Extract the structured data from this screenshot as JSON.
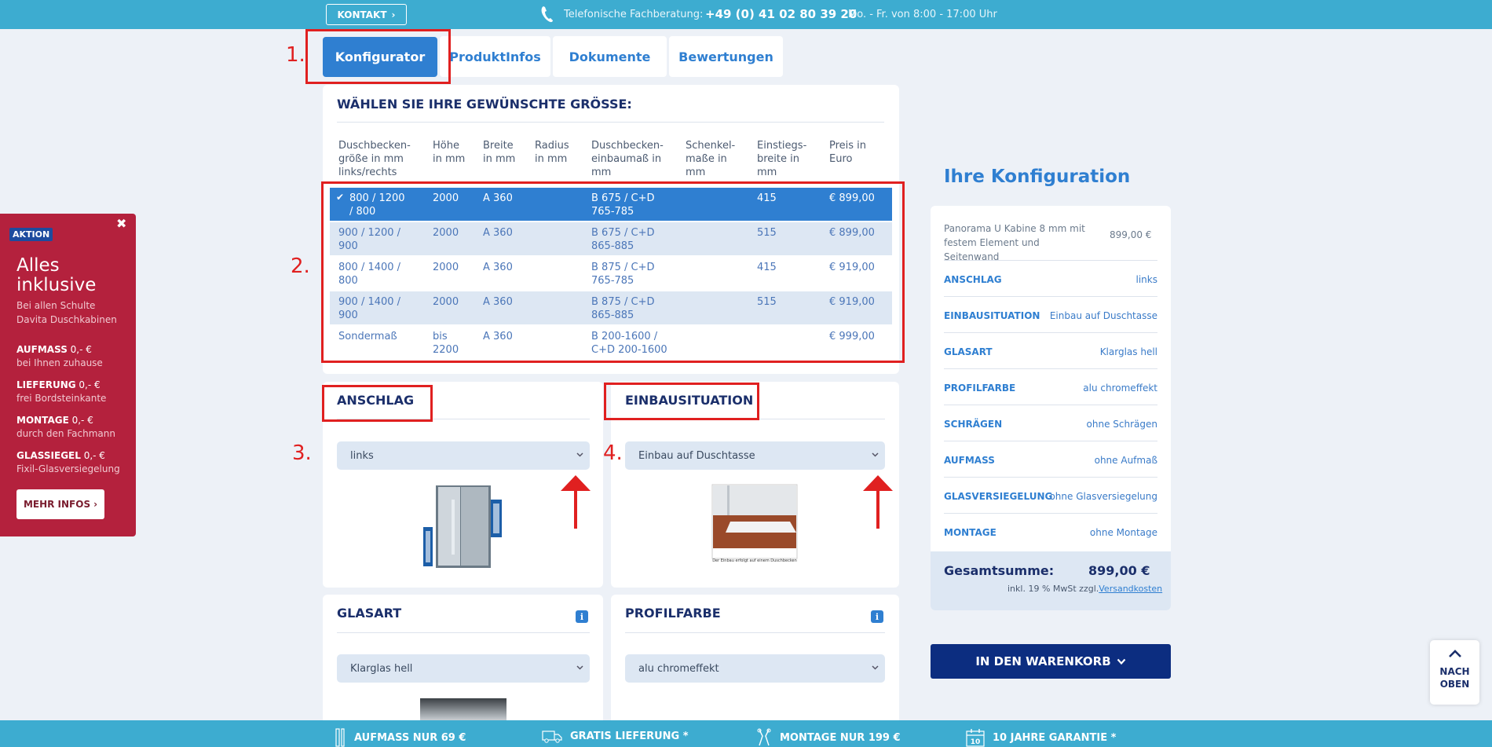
{
  "topbar": {
    "kontakt_label": "KONTAKT",
    "phone_label": "Telefonische Fachberatung:",
    "phone_number": "+49 (0) 41 02 80 39 20",
    "phone_hours": "Mo. - Fr. von 8:00 - 17:00 Uhr"
  },
  "tabs": [
    {
      "label": "Konfigurator",
      "active": true
    },
    {
      "label": "ProduktInfos"
    },
    {
      "label": "Dokumente"
    },
    {
      "label": "Bewertungen"
    }
  ],
  "annotations": [
    "1.",
    "2.",
    "3.",
    "4."
  ],
  "size_table": {
    "title": "WÄHLEN SIE IHRE GEWÜNSCHTE GRÖSSE:",
    "headers": [
      "Duschbecken-\ngröße in mm\nlinks/rechts",
      "Höhe\nin mm",
      "Breite\nin mm",
      "Radius\nin mm",
      "Duschbecken-\neinbaumaß in\nmm",
      "Schenkel-\nmaße in\nmm",
      "Einstiegs-\nbreite in\nmm",
      "Preis in\nEuro"
    ],
    "rows": [
      {
        "size": "800 / 1200\n/ 800",
        "height": "2000",
        "width": "A 360",
        "radius": "",
        "einbau": "B 675 / C+D\n765-785",
        "schenkel": "",
        "einstieg": "415",
        "price": "€ 899,00",
        "selected": true
      },
      {
        "size": "900 / 1200 /\n900",
        "height": "2000",
        "width": "A 360",
        "radius": "",
        "einbau": "B 675 / C+D\n865-885",
        "schenkel": "",
        "einstieg": "515",
        "price": "€ 899,00"
      },
      {
        "size": "800 / 1400 /\n800",
        "height": "2000",
        "width": "A 360",
        "radius": "",
        "einbau": "B 875 / C+D\n765-785",
        "schenkel": "",
        "einstieg": "415",
        "price": "€ 919,00"
      },
      {
        "size": "900 / 1400 /\n900",
        "height": "2000",
        "width": "A 360",
        "radius": "",
        "einbau": "B 875 / C+D\n865-885",
        "schenkel": "",
        "einstieg": "515",
        "price": "€ 919,00"
      },
      {
        "size": "Sondermaß",
        "height": "bis\n2200",
        "width": "A 360",
        "radius": "",
        "einbau": "B 200-1600 /\nC+D 200-1600",
        "schenkel": "",
        "einstieg": "",
        "price": "€ 999,00"
      }
    ]
  },
  "anschlag": {
    "title": "ANSCHLAG",
    "value": "links"
  },
  "einbau": {
    "title": "EINBAUSITUATION",
    "value": "Einbau auf Duschtasse",
    "image_caption": "Der Einbau erfolgt auf einem Duschbecken"
  },
  "glasart": {
    "title": "GLASART",
    "value": "Klarglas hell"
  },
  "profilfarbe": {
    "title": "PROFILFARBE",
    "value": "alu chromeffekt"
  },
  "summary": {
    "title": "Ihre Konfiguration",
    "product": "Panorama U Kabine 8 mm mit festem Element und Seitenwand",
    "product_price": "899,00 €",
    "rows": [
      {
        "label": "ANSCHLAG",
        "value": "links"
      },
      {
        "label": "EINBAUSITUATION",
        "value": "Einbau auf Duschtasse"
      },
      {
        "label": "GLASART",
        "value": "Klarglas hell"
      },
      {
        "label": "PROFILFARBE",
        "value": "alu chromeffekt"
      },
      {
        "label": "SCHRÄGEN",
        "value": "ohne Schrägen"
      },
      {
        "label": "AUFMASS",
        "value": "ohne Aufmaß"
      },
      {
        "label": "GLASVERSIEGELUNG",
        "value": "ohne Glasversiegelung"
      },
      {
        "label": "MONTAGE",
        "value": "ohne Montage"
      }
    ],
    "total_label": "Gesamtsumme:",
    "total_value": "899,00 €",
    "tax_note": "inkl. 19 % MwSt zzgl.",
    "shipping_link": "Versandkosten"
  },
  "cart_button": "IN DEN WARENKORB",
  "aktion": {
    "badge": "AKTION",
    "headline1": "Alles",
    "headline2": "inklusive",
    "sub1": "Bei allen Schulte",
    "sub2": "Davita Duschkabinen",
    "items": [
      {
        "label": "AUFMASS",
        "price": " 0,- €",
        "desc": "bei Ihnen zuhause"
      },
      {
        "label": "LIEFERUNG",
        "price": " 0,- €",
        "desc": "frei Bordsteinkante"
      },
      {
        "label": "MONTAGE",
        "price": " 0,- €",
        "desc": "durch den Fachmann"
      },
      {
        "label": "GLASSIEGEL",
        "price": " 0,- €",
        "desc": "Fixil-Glasversiegelung"
      }
    ],
    "button": "MEHR INFOS"
  },
  "nach_oben": [
    "NACH",
    "OBEN"
  ],
  "bottombar": [
    {
      "label": "AUFMASS NUR 69 €",
      "icon": "ruler-icon"
    },
    {
      "label": "GRATIS LIEFERUNG *",
      "icon": "truck-icon"
    },
    {
      "label": "MONTAGE NUR 199 €",
      "icon": "tools-icon"
    },
    {
      "label": "10 JAHRE GARANTIE *",
      "icon": "calendar-icon"
    }
  ],
  "colors": {
    "accent": "#2f7fd1",
    "topbar": "#3dacd0",
    "navy": "#0c2d80",
    "aktion": "#b4213d",
    "annotation": "#e02020"
  }
}
